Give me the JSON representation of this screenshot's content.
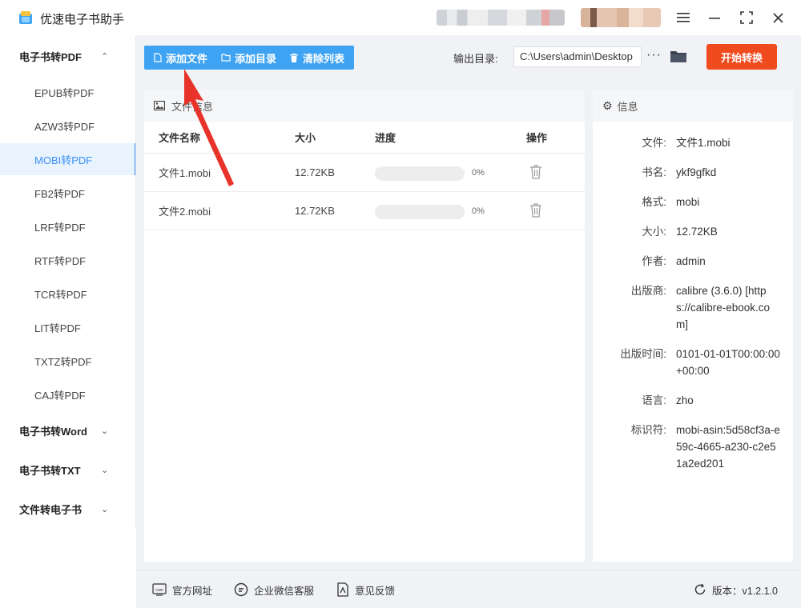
{
  "app": {
    "title": "优速电子书助手"
  },
  "sidebar": {
    "categories": [
      {
        "label": "电子书转PDF",
        "expanded": true
      },
      {
        "label": "电子书转Word",
        "expanded": false
      },
      {
        "label": "电子书转TXT",
        "expanded": false
      },
      {
        "label": "文件转电子书",
        "expanded": false
      }
    ],
    "items": [
      "EPUB转PDF",
      "AZW3转PDF",
      "MOBI转PDF",
      "FB2转PDF",
      "LRF转PDF",
      "RTF转PDF",
      "TCR转PDF",
      "LIT转PDF",
      "TXTZ转PDF",
      "CAJ转PDF"
    ],
    "active_item": "MOBI转PDF"
  },
  "toolbar": {
    "add_file": "添加文件",
    "add_dir": "添加目录",
    "clear_list": "清除列表",
    "output_label": "输出目录:",
    "output_path": "C:\\Users\\admin\\Desktop",
    "more": "···",
    "start": "开始转换"
  },
  "file_panel": {
    "title": "文件信息",
    "columns": {
      "name": "文件名称",
      "size": "大小",
      "progress": "进度",
      "action": "操作"
    },
    "rows": [
      {
        "name": "文件1.mobi",
        "size": "12.72KB",
        "progress": 0,
        "progress_label": "0%"
      },
      {
        "name": "文件2.mobi",
        "size": "12.72KB",
        "progress": 0,
        "progress_label": "0%"
      }
    ]
  },
  "info_panel": {
    "title": "信息",
    "fields": [
      {
        "key": "文件:",
        "value": "文件1.mobi"
      },
      {
        "key": "书名:",
        "value": "ykf9gfkd"
      },
      {
        "key": "格式:",
        "value": "mobi"
      },
      {
        "key": "大小:",
        "value": "12.72KB"
      },
      {
        "key": "作者:",
        "value": "admin"
      },
      {
        "key": "出版商:",
        "value": "calibre (3.6.0) [https://calibre-ebook.com]"
      },
      {
        "key": "出版时间:",
        "value": "0101-01-01T00:00:00+00:00"
      },
      {
        "key": "语言:",
        "value": "zho"
      },
      {
        "key": "标识符:",
        "value": "mobi-asin:5d58cf3a-e59c-4665-a230-c2e51a2ed201"
      }
    ]
  },
  "footer": {
    "website": "官方网址",
    "wechat": "企业微信客服",
    "feedback": "意见反馈",
    "version": "版本：v1.2.1.0"
  },
  "colors": {
    "accent": "#3ea3f2",
    "start": "#f04a1f",
    "annotation_arrow": "#e8332a"
  }
}
